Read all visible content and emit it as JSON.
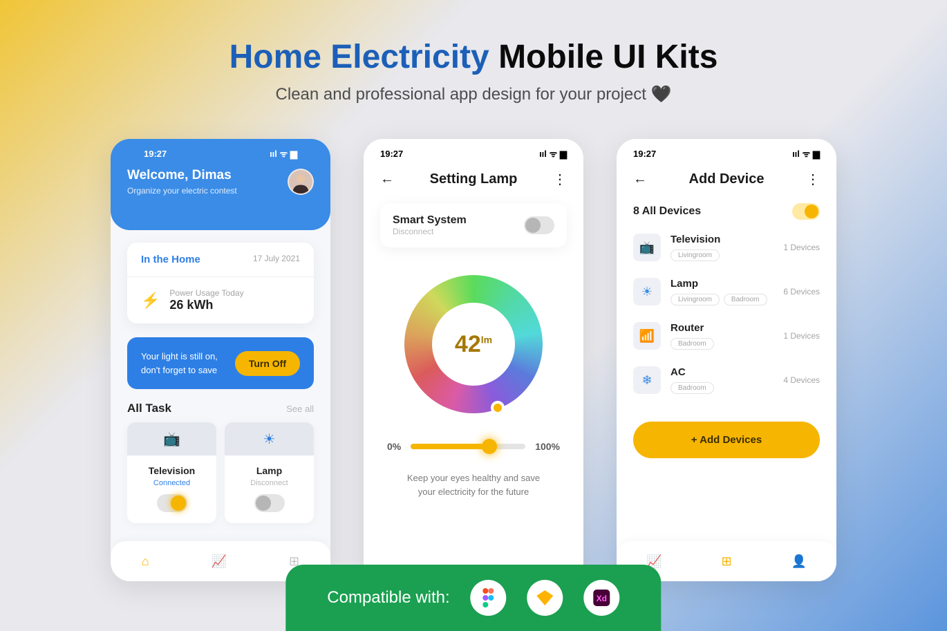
{
  "header": {
    "title_blue": "Home Electricity",
    "title_rest": " Mobile UI Kits",
    "subtitle": "Clean and professional app design for your project 🖤"
  },
  "statusbar": {
    "time": "19:27"
  },
  "screen1": {
    "welcome": "Welcome, Dimas",
    "welcome_sub": "Organize your electric contest",
    "card_label": "In the Home",
    "card_date": "17 July 2021",
    "usage_label": "Power Usage Today",
    "usage_value": "26 kWh",
    "alert_line1": "Your light is still on,",
    "alert_line2": "don't forget to save",
    "alert_btn": "Turn Off",
    "section_title": "All Task",
    "see_all": "See all",
    "tasks": [
      {
        "name": "Television",
        "status": "Connected",
        "on": true
      },
      {
        "name": "Lamp",
        "status": "Disconnect",
        "on": false
      }
    ]
  },
  "screen2": {
    "title": "Setting Lamp",
    "sys_name": "Smart System",
    "sys_sub": "Disconnect",
    "lumens": "42",
    "lumens_unit": "lm",
    "slider_min": "0%",
    "slider_max": "100%",
    "tip": "Keep your eyes healthy and save your electricity for the future"
  },
  "screen3": {
    "title": "Add Device",
    "count": "8 All Devices",
    "devices": [
      {
        "name": "Television",
        "count": "1 Devices",
        "tags": [
          "Livingroom"
        ]
      },
      {
        "name": "Lamp",
        "count": "6 Devices",
        "tags": [
          "Livingroom",
          "Badroom"
        ]
      },
      {
        "name": "Router",
        "count": "1 Devices",
        "tags": [
          "Badroom"
        ]
      },
      {
        "name": "AC",
        "count": "4 Devices",
        "tags": [
          "Badroom"
        ]
      }
    ],
    "add_btn": "+   Add Devices"
  },
  "footer": {
    "label": "Compatible with:"
  }
}
